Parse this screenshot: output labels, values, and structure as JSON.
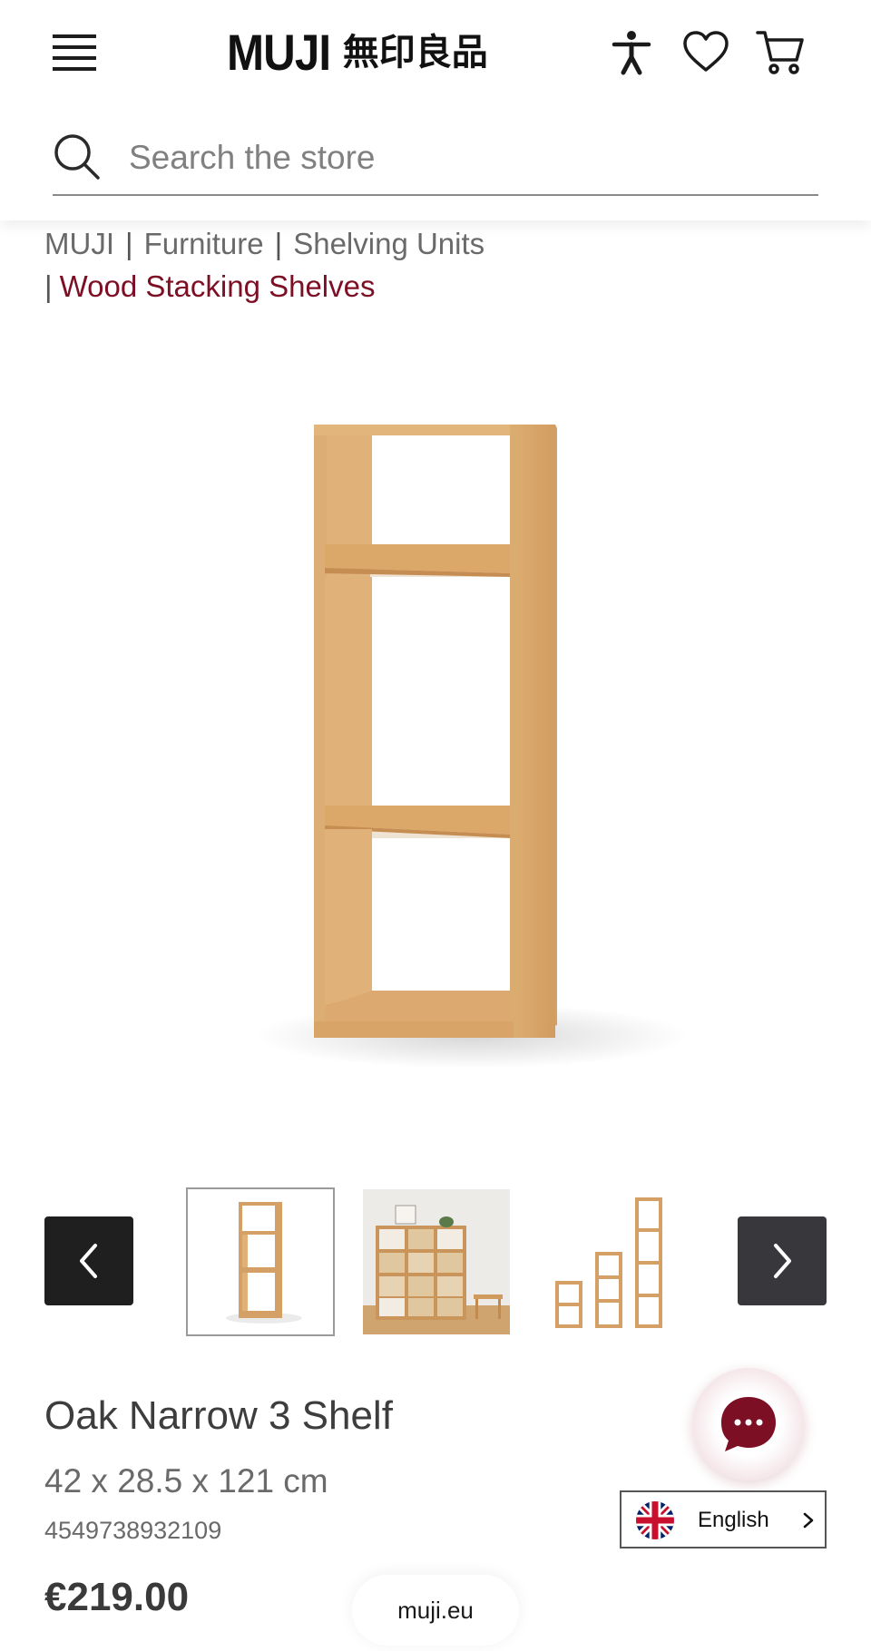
{
  "header": {
    "logo_latin": "MUJI",
    "logo_kanji": "無印良品",
    "icons": [
      "menu-icon",
      "accessibility-icon",
      "heart-icon",
      "cart-icon"
    ]
  },
  "search": {
    "placeholder": "Search the store"
  },
  "breadcrumb": {
    "items": [
      "MUJI",
      "Furniture",
      "Shelving Units"
    ],
    "current": "Wood Stacking Shelves",
    "separator": "|"
  },
  "gallery": {
    "thumbnails": [
      "shelf-front-view",
      "shelf-room-setting",
      "shelf-size-variants"
    ],
    "selected_index": 0
  },
  "product": {
    "title": "Oak Narrow 3 Shelf",
    "dimensions": "42 x 28.5 x 121 cm",
    "sku": "4549738932109",
    "price": "€219.00"
  },
  "language": {
    "label": "English"
  },
  "footer": {
    "domain": "muji.eu"
  },
  "colors": {
    "accent": "#7d0f24",
    "text": "#3c3c3c",
    "wood": "#d9a66a"
  }
}
